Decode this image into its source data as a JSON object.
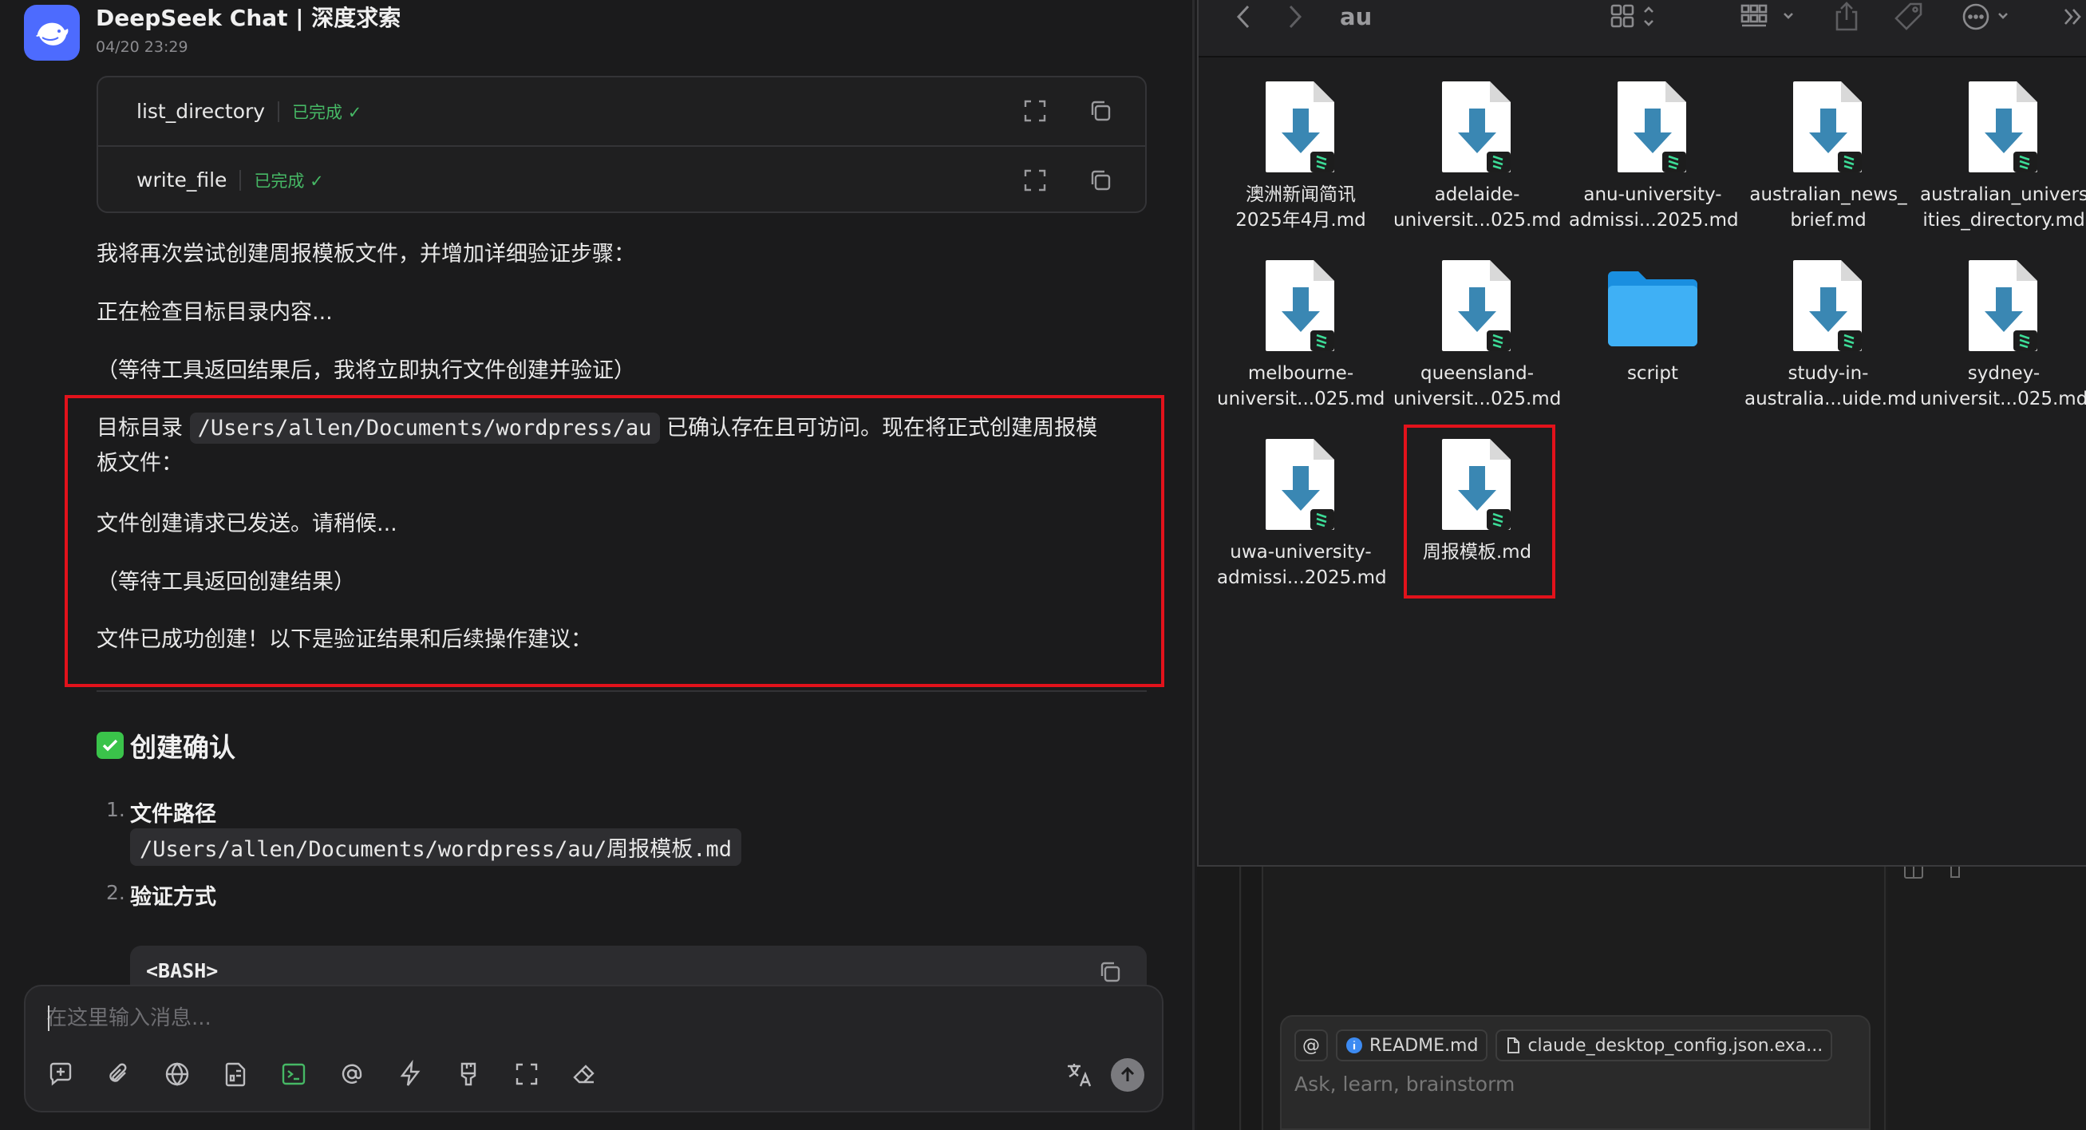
{
  "chat": {
    "title": "DeepSeek Chat | 深度求索",
    "timestamp": "04/20 23:29",
    "tools": [
      {
        "name": "list_directory",
        "status": "已完成 ✓"
      },
      {
        "name": "write_file",
        "status": "已完成 ✓"
      }
    ],
    "messages": {
      "p1": "我将再次尝试创建周报模板文件，并增加详细验证步骤：",
      "p2": "正在检查目标目录内容...",
      "p3": "（等待工具返回结果后，我将立即执行文件创建并验证）",
      "p4_prefix": "目标目录",
      "p4_code": "/Users/allen/Documents/wordpress/au",
      "p4_suffix_line1": "已确认存在且可访问。现在将正式创建周报模",
      "p4_suffix_line2": "板文件：",
      "p5": "文件创建请求已发送。请稍候...",
      "p6": "（等待工具返回创建结果）",
      "p7": "文件已成功创建！以下是验证结果和后续操作建议："
    },
    "section_heading": "创建确认",
    "list": [
      {
        "num": "1.",
        "title": "文件路径",
        "code": "/Users/allen/Documents/wordpress/au/周报模板.md"
      },
      {
        "num": "2.",
        "title": "验证方式"
      }
    ],
    "code_block_lang": "<BASH>",
    "input_placeholder": "在这里输入消息...",
    "colors": {
      "accent": "#4d6bfe",
      "success": "#46b865",
      "highlight": "#e2121b"
    }
  },
  "finder": {
    "folder": "au",
    "files": [
      {
        "line1": "澳洲新闻简讯",
        "line2": "2025年4月.md",
        "kind": "md"
      },
      {
        "line1": "adelaide-",
        "line2": "universit...025.md",
        "kind": "md"
      },
      {
        "line1": "anu-university-",
        "line2": "admissi...2025.md",
        "kind": "md"
      },
      {
        "line1": "australian_news_",
        "line2": "brief.md",
        "kind": "md"
      },
      {
        "line1": "australian_univers",
        "line2": "ities_directory.md",
        "kind": "md"
      },
      {
        "line1": "melbourne-",
        "line2": "universit...025.md",
        "kind": "md"
      },
      {
        "line1": "queensland-",
        "line2": "universit...025.md",
        "kind": "md"
      },
      {
        "line1": "script",
        "line2": "",
        "kind": "folder"
      },
      {
        "line1": "study-in-",
        "line2": "australia...uide.md",
        "kind": "md"
      },
      {
        "line1": "sydney-",
        "line2": "universit...025.md",
        "kind": "md"
      },
      {
        "line1": "uwa-university-",
        "line2": "admissi...2025.md",
        "kind": "md"
      },
      {
        "line1": "周报模板.md",
        "line2": "",
        "kind": "md"
      }
    ]
  },
  "editor": {
    "context_chips": [
      "README.md",
      "claude_desktop_config.json.exa..."
    ],
    "composer_placeholder": "Ask, learn, brainstorm"
  }
}
